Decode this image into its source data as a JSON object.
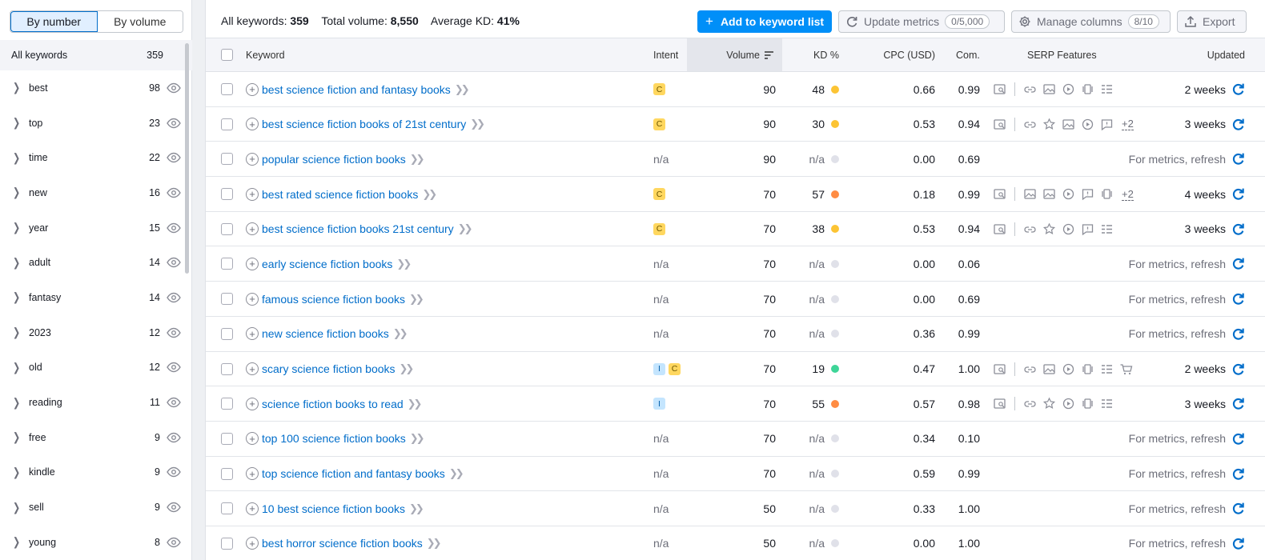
{
  "left_panel": {
    "toggle": [
      "By number",
      "By volume"
    ],
    "all_keywords": {
      "label": "All keywords",
      "count": "359"
    },
    "groups": [
      {
        "name": "best",
        "count": "98"
      },
      {
        "name": "top",
        "count": "23"
      },
      {
        "name": "time",
        "count": "22"
      },
      {
        "name": "new",
        "count": "16"
      },
      {
        "name": "year",
        "count": "15"
      },
      {
        "name": "adult",
        "count": "14"
      },
      {
        "name": "fantasy",
        "count": "14"
      },
      {
        "name": "2023",
        "count": "12"
      },
      {
        "name": "old",
        "count": "12"
      },
      {
        "name": "reading",
        "count": "11"
      },
      {
        "name": "free",
        "count": "9"
      },
      {
        "name": "kindle",
        "count": "9"
      },
      {
        "name": "sell",
        "count": "9"
      },
      {
        "name": "young",
        "count": "8"
      }
    ]
  },
  "summary": {
    "all_keywords_label": "All keywords:",
    "all_keywords_value": "359",
    "total_volume_label": "Total volume:",
    "total_volume_value": "8,550",
    "avg_kd_label": "Average KD:",
    "avg_kd_value": "41%"
  },
  "toolbar": {
    "add_label": "Add to keyword list",
    "update_label": "Update metrics",
    "update_pill": "0/5,000",
    "manage_label": "Manage columns",
    "manage_pill": "8/10",
    "export_label": "Export"
  },
  "columns": {
    "keyword": "Keyword",
    "intent": "Intent",
    "volume": "Volume",
    "kd": "KD %",
    "cpc": "CPC (USD)",
    "com": "Com.",
    "serp": "SERP Features",
    "updated": "Updated"
  },
  "colors": {
    "yellow": "#fcc434",
    "orange": "#ff8c43",
    "green": "#3ed598",
    "gray": "#e0e1e9"
  },
  "rows": [
    {
      "keyword": "best science fiction and fantasy books",
      "intent": [
        "C"
      ],
      "volume": "90",
      "kd": "48",
      "kd_color": "yellow",
      "cpc": "0.66",
      "com": "0.99",
      "serp": [
        "snippet-icon",
        "sep",
        "link-icon",
        "image-icon",
        "video-icon",
        "carousel-icon",
        "list-icon"
      ],
      "serp_more": "",
      "updated": "2 weeks"
    },
    {
      "keyword": "best science fiction books of 21st century",
      "intent": [
        "C"
      ],
      "volume": "90",
      "kd": "30",
      "kd_color": "yellow",
      "cpc": "0.53",
      "com": "0.94",
      "serp": [
        "snippet-icon",
        "sep",
        "link-icon",
        "star-icon",
        "image-icon",
        "video-icon",
        "comment-icon"
      ],
      "serp_more": "+2",
      "updated": "3 weeks"
    },
    {
      "keyword": "popular science fiction books",
      "intent": [],
      "intent_na": "n/a",
      "volume": "90",
      "kd": "n/a",
      "kd_color": "gray",
      "cpc": "0.00",
      "com": "0.69",
      "serp": [],
      "serp_more": "",
      "updated": "For metrics, refresh"
    },
    {
      "keyword": "best rated science fiction books",
      "intent": [
        "C"
      ],
      "volume": "70",
      "kd": "57",
      "kd_color": "orange",
      "cpc": "0.18",
      "com": "0.99",
      "serp": [
        "snippet-icon",
        "sep",
        "image-icon",
        "image-icon",
        "video-icon",
        "comment-icon",
        "carousel-icon"
      ],
      "serp_more": "+2",
      "updated": "4 weeks"
    },
    {
      "keyword": "best science fiction books 21st century",
      "intent": [
        "C"
      ],
      "volume": "70",
      "kd": "38",
      "kd_color": "yellow",
      "cpc": "0.53",
      "com": "0.94",
      "serp": [
        "snippet-icon",
        "sep",
        "link-icon",
        "star-icon",
        "video-icon",
        "comment-icon",
        "list-icon"
      ],
      "serp_more": "",
      "updated": "3 weeks"
    },
    {
      "keyword": "early science fiction books",
      "intent": [],
      "intent_na": "n/a",
      "volume": "70",
      "kd": "n/a",
      "kd_color": "gray",
      "cpc": "0.00",
      "com": "0.06",
      "serp": [],
      "serp_more": "",
      "updated": "For metrics, refresh"
    },
    {
      "keyword": "famous science fiction books",
      "intent": [],
      "intent_na": "n/a",
      "volume": "70",
      "kd": "n/a",
      "kd_color": "gray",
      "cpc": "0.00",
      "com": "0.69",
      "serp": [],
      "serp_more": "",
      "updated": "For metrics, refresh"
    },
    {
      "keyword": "new science fiction books",
      "intent": [],
      "intent_na": "n/a",
      "volume": "70",
      "kd": "n/a",
      "kd_color": "gray",
      "cpc": "0.36",
      "com": "0.99",
      "serp": [],
      "serp_more": "",
      "updated": "For metrics, refresh"
    },
    {
      "keyword": "scary science fiction books",
      "intent": [
        "I",
        "C"
      ],
      "volume": "70",
      "kd": "19",
      "kd_color": "green",
      "cpc": "0.47",
      "com": "1.00",
      "serp": [
        "snippet-icon",
        "sep",
        "link-icon",
        "image-icon",
        "video-icon",
        "carousel-icon",
        "list-icon",
        "cart-icon"
      ],
      "serp_more": "",
      "updated": "2 weeks"
    },
    {
      "keyword": "science fiction books to read",
      "intent": [
        "I"
      ],
      "volume": "70",
      "kd": "55",
      "kd_color": "orange",
      "cpc": "0.57",
      "com": "0.98",
      "serp": [
        "snippet-icon",
        "sep",
        "link-icon",
        "star-icon",
        "video-icon",
        "carousel-icon",
        "list-icon"
      ],
      "serp_more": "",
      "updated": "3 weeks"
    },
    {
      "keyword": "top 100 science fiction books",
      "intent": [],
      "intent_na": "n/a",
      "volume": "70",
      "kd": "n/a",
      "kd_color": "gray",
      "cpc": "0.34",
      "com": "0.10",
      "serp": [],
      "serp_more": "",
      "updated": "For metrics, refresh"
    },
    {
      "keyword": "top science fiction and fantasy books",
      "intent": [],
      "intent_na": "n/a",
      "volume": "70",
      "kd": "n/a",
      "kd_color": "gray",
      "cpc": "0.59",
      "com": "0.99",
      "serp": [],
      "serp_more": "",
      "updated": "For metrics, refresh"
    },
    {
      "keyword": "10 best science fiction books",
      "intent": [],
      "intent_na": "n/a",
      "volume": "50",
      "kd": "n/a",
      "kd_color": "gray",
      "cpc": "0.33",
      "com": "1.00",
      "serp": [],
      "serp_more": "",
      "updated": "For metrics, refresh"
    },
    {
      "keyword": "best horror science fiction books",
      "intent": [],
      "intent_na": "n/a",
      "volume": "50",
      "kd": "n/a",
      "kd_color": "gray",
      "cpc": "0.00",
      "com": "1.00",
      "serp": [],
      "serp_more": "",
      "updated": "For metrics, refresh"
    }
  ]
}
